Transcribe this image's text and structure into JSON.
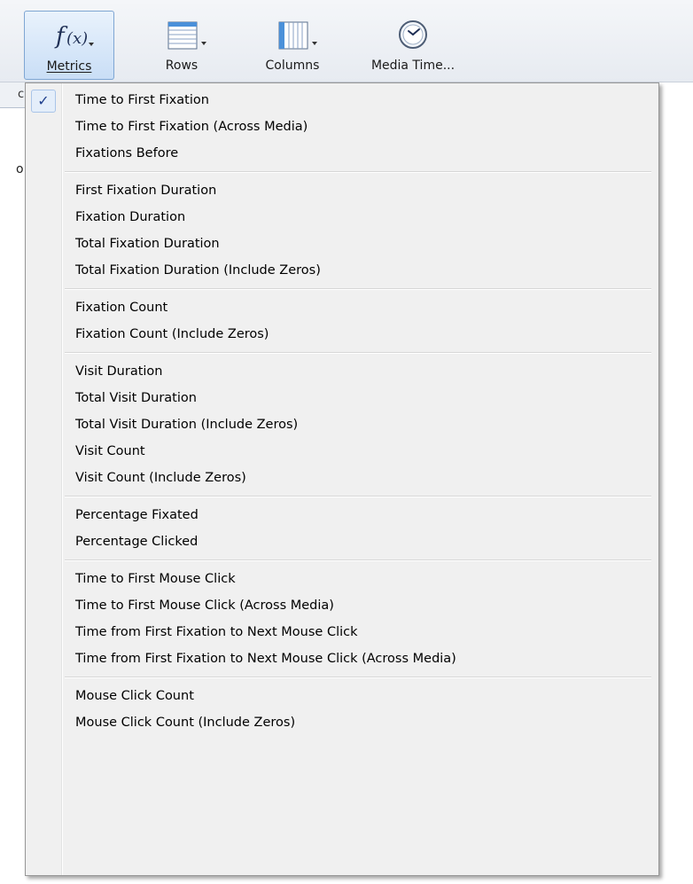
{
  "toolbar": {
    "buttons": [
      {
        "id": "metrics",
        "label": "Metrics",
        "icon": "function-fx-icon"
      },
      {
        "id": "rows",
        "label": "Rows",
        "icon": "table-rows-icon"
      },
      {
        "id": "columns",
        "label": "Columns",
        "icon": "table-columns-icon"
      },
      {
        "id": "media_time",
        "label": "Media Time...",
        "icon": "clock-icon"
      }
    ]
  },
  "background": {
    "subbar_text": "c",
    "fragment_text": "o"
  },
  "menu": {
    "checkmark": "✓",
    "groups": [
      [
        "Time to First Fixation",
        "Time to First Fixation (Across Media)",
        "Fixations Before"
      ],
      [
        "First Fixation Duration",
        "Fixation Duration",
        "Total Fixation Duration",
        "Total Fixation Duration (Include Zeros)"
      ],
      [
        "Fixation Count",
        "Fixation Count (Include Zeros)"
      ],
      [
        "Visit Duration",
        "Total Visit Duration",
        "Total Visit Duration (Include Zeros)",
        "Visit Count",
        "Visit Count (Include Zeros)"
      ],
      [
        "Percentage Fixated",
        "Percentage Clicked"
      ],
      [
        "Time to First Mouse Click",
        "Time to First Mouse Click (Across Media)",
        "Time from First Fixation to Next Mouse Click",
        "Time from First Fixation to Next Mouse Click (Across Media)"
      ],
      [
        "Mouse Click Count",
        "Mouse Click Count (Include Zeros)"
      ]
    ],
    "checked_item": "Time to First Fixation"
  },
  "colors": {
    "accent": "#7fa6d3",
    "checkmark": "#1f3f8c",
    "menu_bg": "#f0f0f0"
  }
}
